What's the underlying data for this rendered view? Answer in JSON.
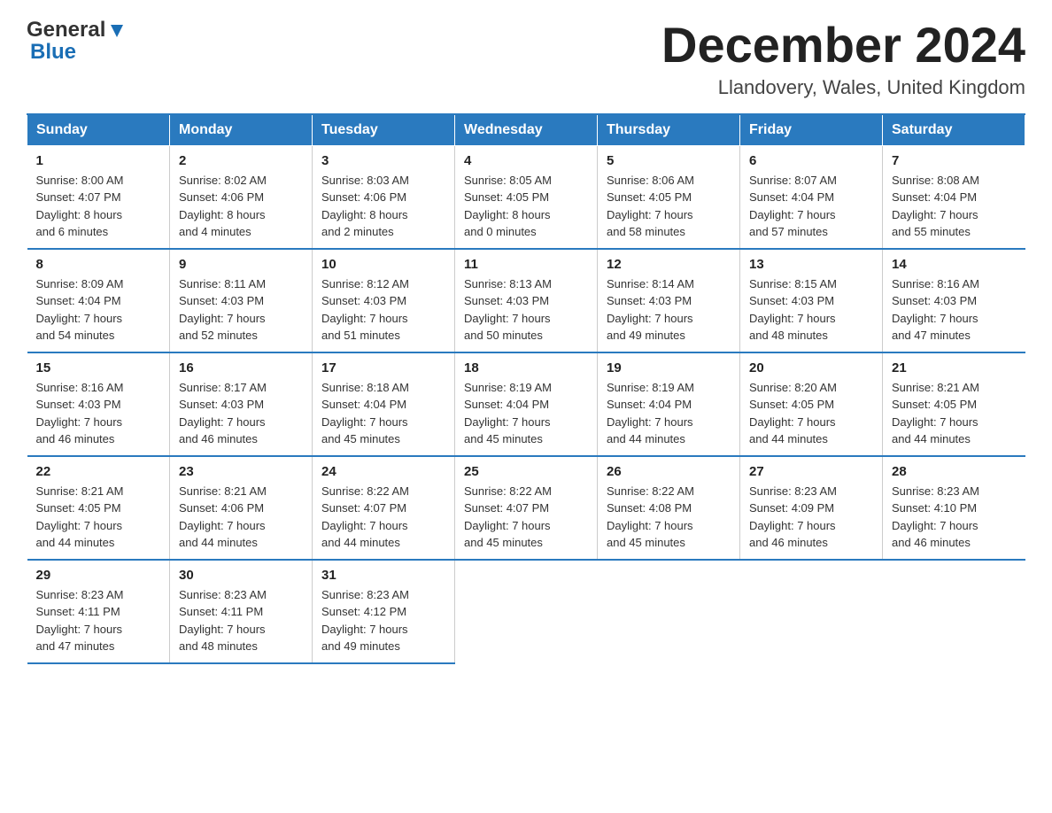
{
  "header": {
    "logo_general": "General",
    "logo_blue": "Blue",
    "title": "December 2024",
    "location": "Llandovery, Wales, United Kingdom"
  },
  "weekdays": [
    "Sunday",
    "Monday",
    "Tuesday",
    "Wednesday",
    "Thursday",
    "Friday",
    "Saturday"
  ],
  "weeks": [
    [
      {
        "day": "1",
        "sunrise": "8:00 AM",
        "sunset": "4:07 PM",
        "daylight": "8 hours and 6 minutes."
      },
      {
        "day": "2",
        "sunrise": "8:02 AM",
        "sunset": "4:06 PM",
        "daylight": "8 hours and 4 minutes."
      },
      {
        "day": "3",
        "sunrise": "8:03 AM",
        "sunset": "4:06 PM",
        "daylight": "8 hours and 2 minutes."
      },
      {
        "day": "4",
        "sunrise": "8:05 AM",
        "sunset": "4:05 PM",
        "daylight": "8 hours and 0 minutes."
      },
      {
        "day": "5",
        "sunrise": "8:06 AM",
        "sunset": "4:05 PM",
        "daylight": "7 hours and 58 minutes."
      },
      {
        "day": "6",
        "sunrise": "8:07 AM",
        "sunset": "4:04 PM",
        "daylight": "7 hours and 57 minutes."
      },
      {
        "day": "7",
        "sunrise": "8:08 AM",
        "sunset": "4:04 PM",
        "daylight": "7 hours and 55 minutes."
      }
    ],
    [
      {
        "day": "8",
        "sunrise": "8:09 AM",
        "sunset": "4:04 PM",
        "daylight": "7 hours and 54 minutes."
      },
      {
        "day": "9",
        "sunrise": "8:11 AM",
        "sunset": "4:03 PM",
        "daylight": "7 hours and 52 minutes."
      },
      {
        "day": "10",
        "sunrise": "8:12 AM",
        "sunset": "4:03 PM",
        "daylight": "7 hours and 51 minutes."
      },
      {
        "day": "11",
        "sunrise": "8:13 AM",
        "sunset": "4:03 PM",
        "daylight": "7 hours and 50 minutes."
      },
      {
        "day": "12",
        "sunrise": "8:14 AM",
        "sunset": "4:03 PM",
        "daylight": "7 hours and 49 minutes."
      },
      {
        "day": "13",
        "sunrise": "8:15 AM",
        "sunset": "4:03 PM",
        "daylight": "7 hours and 48 minutes."
      },
      {
        "day": "14",
        "sunrise": "8:16 AM",
        "sunset": "4:03 PM",
        "daylight": "7 hours and 47 minutes."
      }
    ],
    [
      {
        "day": "15",
        "sunrise": "8:16 AM",
        "sunset": "4:03 PM",
        "daylight": "7 hours and 46 minutes."
      },
      {
        "day": "16",
        "sunrise": "8:17 AM",
        "sunset": "4:03 PM",
        "daylight": "7 hours and 46 minutes."
      },
      {
        "day": "17",
        "sunrise": "8:18 AM",
        "sunset": "4:04 PM",
        "daylight": "7 hours and 45 minutes."
      },
      {
        "day": "18",
        "sunrise": "8:19 AM",
        "sunset": "4:04 PM",
        "daylight": "7 hours and 45 minutes."
      },
      {
        "day": "19",
        "sunrise": "8:19 AM",
        "sunset": "4:04 PM",
        "daylight": "7 hours and 44 minutes."
      },
      {
        "day": "20",
        "sunrise": "8:20 AM",
        "sunset": "4:05 PM",
        "daylight": "7 hours and 44 minutes."
      },
      {
        "day": "21",
        "sunrise": "8:21 AM",
        "sunset": "4:05 PM",
        "daylight": "7 hours and 44 minutes."
      }
    ],
    [
      {
        "day": "22",
        "sunrise": "8:21 AM",
        "sunset": "4:05 PM",
        "daylight": "7 hours and 44 minutes."
      },
      {
        "day": "23",
        "sunrise": "8:21 AM",
        "sunset": "4:06 PM",
        "daylight": "7 hours and 44 minutes."
      },
      {
        "day": "24",
        "sunrise": "8:22 AM",
        "sunset": "4:07 PM",
        "daylight": "7 hours and 44 minutes."
      },
      {
        "day": "25",
        "sunrise": "8:22 AM",
        "sunset": "4:07 PM",
        "daylight": "7 hours and 45 minutes."
      },
      {
        "day": "26",
        "sunrise": "8:22 AM",
        "sunset": "4:08 PM",
        "daylight": "7 hours and 45 minutes."
      },
      {
        "day": "27",
        "sunrise": "8:23 AM",
        "sunset": "4:09 PM",
        "daylight": "7 hours and 46 minutes."
      },
      {
        "day": "28",
        "sunrise": "8:23 AM",
        "sunset": "4:10 PM",
        "daylight": "7 hours and 46 minutes."
      }
    ],
    [
      {
        "day": "29",
        "sunrise": "8:23 AM",
        "sunset": "4:11 PM",
        "daylight": "7 hours and 47 minutes."
      },
      {
        "day": "30",
        "sunrise": "8:23 AM",
        "sunset": "4:11 PM",
        "daylight": "7 hours and 48 minutes."
      },
      {
        "day": "31",
        "sunrise": "8:23 AM",
        "sunset": "4:12 PM",
        "daylight": "7 hours and 49 minutes."
      },
      null,
      null,
      null,
      null
    ]
  ],
  "labels": {
    "sunrise": "Sunrise:",
    "sunset": "Sunset:",
    "daylight": "Daylight:"
  }
}
